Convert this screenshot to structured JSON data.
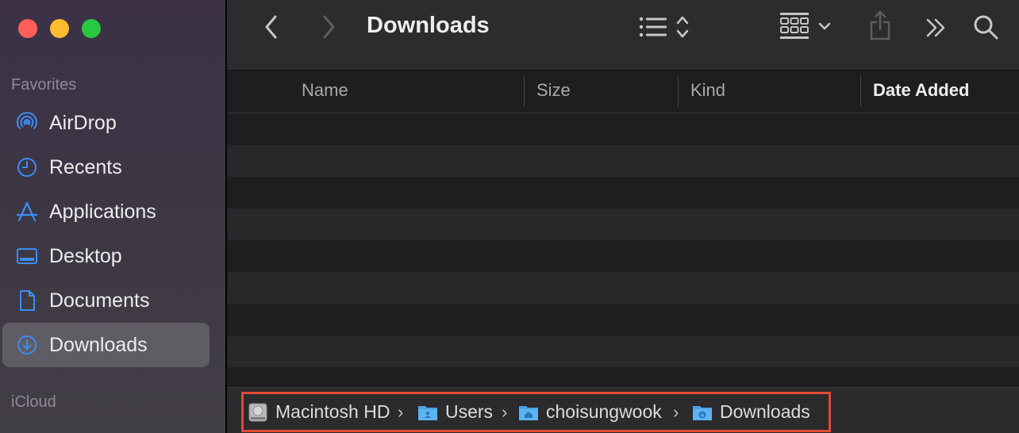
{
  "window": {
    "title": "Downloads"
  },
  "sidebar": {
    "favorites_label": "Favorites",
    "icloud_label": "iCloud",
    "items": [
      {
        "label": "AirDrop",
        "icon": "airdrop-icon",
        "active": false
      },
      {
        "label": "Recents",
        "icon": "clock-icon",
        "active": false
      },
      {
        "label": "Applications",
        "icon": "applications-icon",
        "active": false
      },
      {
        "label": "Desktop",
        "icon": "desktop-icon",
        "active": false
      },
      {
        "label": "Documents",
        "icon": "document-icon",
        "active": false
      },
      {
        "label": "Downloads",
        "icon": "download-icon",
        "active": true
      }
    ]
  },
  "toolbar": {
    "back": "back-chevron-icon",
    "forward": "forward-chevron-icon",
    "view_list": "list-view-icon",
    "group": "group-grid-icon",
    "share": "share-icon",
    "more": "more-chevrons-icon",
    "search": "search-icon"
  },
  "columns": {
    "name": "Name",
    "size": "Size",
    "kind": "Kind",
    "date_added": "Date Added"
  },
  "pathbar": {
    "crumbs": [
      {
        "label": "Macintosh HD",
        "icon": "hard-drive-icon"
      },
      {
        "label": "Users",
        "icon": "users-folder-icon"
      },
      {
        "label": "choisungwook",
        "icon": "home-folder-icon"
      },
      {
        "label": "Downloads",
        "icon": "downloads-folder-icon"
      }
    ],
    "separator": "›"
  },
  "colors": {
    "accent": "#3b8ef5",
    "highlight_box": "#e14b33",
    "close": "#ff5f57",
    "minimize": "#febc2e",
    "zoom": "#28c840"
  }
}
